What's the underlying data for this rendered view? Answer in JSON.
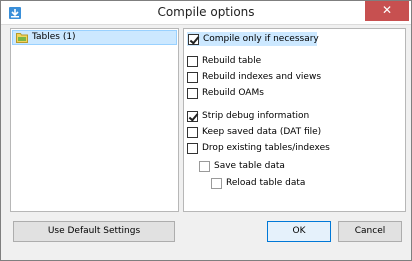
{
  "window": {
    "title": "Compile options",
    "close_glyph": "✕",
    "app_icon": "app-icon",
    "accent_color": "#c75050"
  },
  "tree": {
    "items": [
      {
        "label": "Tables (1)",
        "icon": "folder-icon",
        "selected": true
      }
    ]
  },
  "options": {
    "compile_only": {
      "label": "Compile only if necessary",
      "checked": true
    },
    "rebuild_table": {
      "label": "Rebuild table",
      "checked": false
    },
    "rebuild_indexes": {
      "label": "Rebuild indexes and views",
      "checked": false
    },
    "rebuild_oams": {
      "label": "Rebuild OAMs",
      "checked": false
    },
    "strip_debug": {
      "label": "Strip debug information",
      "checked": true
    },
    "keep_saved": {
      "label": "Keep saved data (DAT file)",
      "checked": false
    },
    "drop_existing": {
      "label": "Drop existing tables/indexes",
      "checked": false
    },
    "save_table": {
      "label": "Save table data",
      "checked": false,
      "enabled": false
    },
    "reload_table": {
      "label": "Reload table data",
      "checked": false,
      "enabled": false
    }
  },
  "buttons": {
    "use_default": "Use Default Settings",
    "ok": "OK",
    "cancel": "Cancel"
  }
}
